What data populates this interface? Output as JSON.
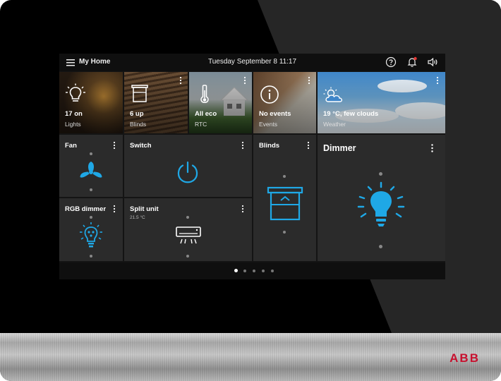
{
  "topbar": {
    "title": "My Home",
    "datetime": "Tuesday  September 8  11:17",
    "icons": [
      "menu-icon",
      "help-icon",
      "bell-icon",
      "speaker-icon"
    ]
  },
  "tiles": {
    "lights": {
      "title": "17 on",
      "subtitle": "Lights",
      "icon": "lightbulb-icon"
    },
    "blinds_photo": {
      "title": "6 up",
      "subtitle": "Blinds",
      "icon": "blinds-icon"
    },
    "rtc": {
      "title": "All eco",
      "subtitle": "RTC",
      "icon": "thermometer-icon"
    },
    "events": {
      "title": "No events",
      "subtitle": "Events",
      "icon": "info-icon"
    },
    "weather": {
      "title": "19 °C, few clouds",
      "subtitle": "Weather",
      "icon": "partly-cloudy-icon"
    },
    "fan": {
      "label": "Fan",
      "icon": "fan-icon"
    },
    "switch": {
      "label": "Switch",
      "icon": "power-icon"
    },
    "blinds": {
      "label": "Blinds",
      "icon": "blinds-icon"
    },
    "dimmer": {
      "label": "Dimmer",
      "icon": "lightbulb-icon"
    },
    "rgb_dimmer": {
      "label": "RGB dimmer",
      "icon": "rgb-bulb-icon"
    },
    "split_unit": {
      "label": "Split unit",
      "sublabel": "21.5 °C",
      "icon": "air-conditioner-icon"
    }
  },
  "pager": {
    "pages": 5,
    "active_page": 1
  },
  "brand": {
    "logo": "ABB"
  },
  "colors": {
    "accent": "#1fa8e6",
    "tile_bg": "#2b2b2b",
    "screen_bg": "#141414",
    "notification": "#e53935"
  }
}
